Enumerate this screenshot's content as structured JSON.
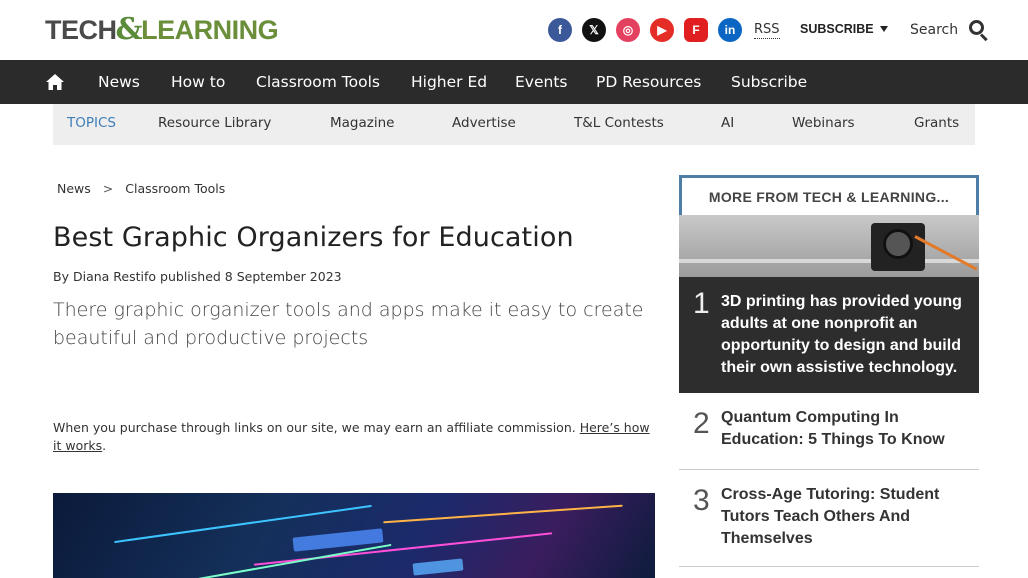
{
  "header": {
    "logo_left": "TECH",
    "logo_amp": "&",
    "logo_right": "LEARNING",
    "socials": [
      {
        "icon": "facebook-icon",
        "glyph": "f"
      },
      {
        "icon": "x-icon",
        "glyph": "𝕏"
      },
      {
        "icon": "instagram-icon",
        "glyph": "◎"
      },
      {
        "icon": "youtube-icon",
        "glyph": "▶"
      },
      {
        "icon": "flipboard-icon",
        "glyph": "F"
      },
      {
        "icon": "linkedin-icon",
        "glyph": "in"
      }
    ],
    "rss": "RSS",
    "subscribe": "SUBSCRIBE",
    "search": "Search"
  },
  "nav": {
    "items": [
      "News",
      "How to",
      "Classroom Tools",
      "Higher Ed",
      "Events",
      "PD Resources",
      "Subscribe"
    ]
  },
  "topics": {
    "label": "TOPICS",
    "items": [
      "Resource Library",
      "Magazine",
      "Advertise",
      "T&L Contests",
      "AI",
      "Webinars",
      "Grants"
    ]
  },
  "article": {
    "breadcrumb": [
      "News",
      "Classroom Tools"
    ],
    "breadcrumb_sep": ">",
    "title": "Best Graphic Organizers for Education",
    "byline_prefix": "By",
    "author": "Diana Restifo",
    "published": "published 8 September 2023",
    "subtitle": "There graphic organizer tools and apps make it easy to create beautiful and productive projects",
    "affiliate_text": "When you purchase through links on our site, we may earn an affiliate commission.",
    "affiliate_link": "Here’s how it works",
    "affiliate_end": "."
  },
  "sidebar": {
    "heading": "MORE FROM TECH & LEARNING...",
    "items": [
      {
        "num": "1",
        "text": "3D printing has provided young adults at one nonprofit an opportunity to design and build their own assistive technology."
      },
      {
        "num": "2",
        "text": "Quantum Computing In Education: 5 Things To Know"
      },
      {
        "num": "3",
        "text": "Cross-Age Tutoring: Student Tutors Teach Others And Themselves"
      }
    ]
  },
  "colors": {
    "nav_bg": "#2b2b2b",
    "topics_accent": "#3f7fb8",
    "sidebar_border": "#4d7ea8",
    "logo_green": "#6b8e3a"
  }
}
